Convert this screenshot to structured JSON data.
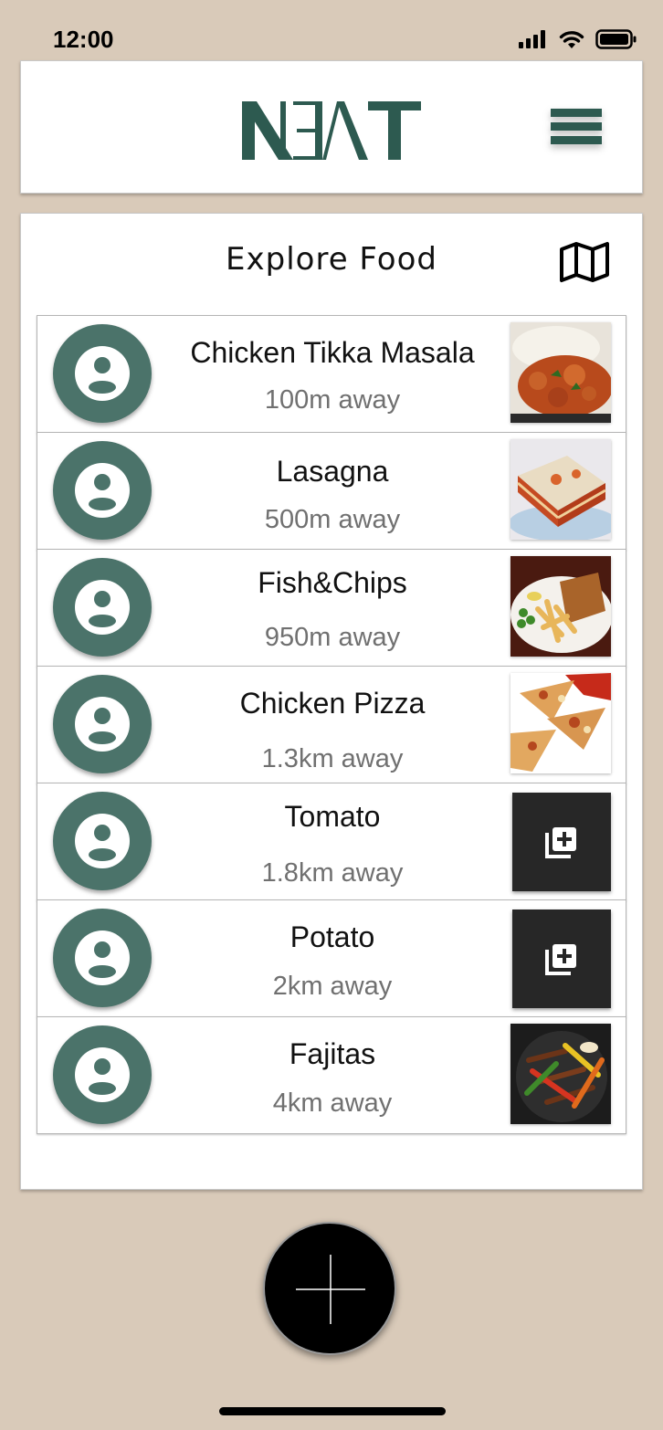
{
  "status": {
    "time": "12:00"
  },
  "header": {
    "logo": "NEAT",
    "menu_icon": "hamburger-menu-icon"
  },
  "page": {
    "title": "Explore Food",
    "map_icon": "map-icon"
  },
  "food_items": [
    {
      "name": "Chicken Tikka Masala",
      "distance": "100m away",
      "thumb": "photo"
    },
    {
      "name": "Lasagna",
      "distance": "500m away",
      "thumb": "photo"
    },
    {
      "name": "Fish&Chips",
      "distance": "950m away",
      "thumb": "photo"
    },
    {
      "name": "Chicken Pizza",
      "distance": "1.3km away",
      "thumb": "photo"
    },
    {
      "name": "Tomato",
      "distance": "1.8km away",
      "thumb": "add-photo"
    },
    {
      "name": "Potato",
      "distance": "2km away",
      "thumb": "add-photo"
    },
    {
      "name": "Fajitas",
      "distance": "4km away",
      "thumb": "photo"
    }
  ],
  "colors": {
    "background": "#d9cab9",
    "brand": "#2d5a50",
    "avatar": "#4b736a",
    "fab": "#000000"
  }
}
